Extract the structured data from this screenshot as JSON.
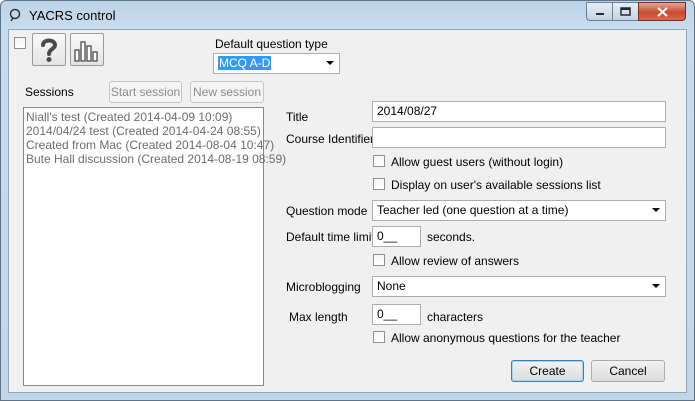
{
  "window": {
    "title": "YACRS control"
  },
  "toolbar": {
    "help_icon": "question-mark-icon",
    "chart_icon": "bar-chart-icon"
  },
  "question_type": {
    "label": "Default question type",
    "value": "MCQ A-D"
  },
  "sessions": {
    "label": "Sessions",
    "start_button": "Start session",
    "new_button": "New session",
    "items": [
      "Niall's test (Created 2014-04-09 10:09)",
      "2014/04/24 test (Created 2014-04-24 08:55)",
      "Created from Mac (Created 2014-08-04 10:47)",
      "Bute Hall discussion (Created 2014-08-19 08:59)"
    ]
  },
  "form": {
    "title_label": "Title",
    "title_value": "2014/08/27",
    "course_label": "Course Identifier",
    "course_value": "",
    "guest_label": "Allow guest users (without login)",
    "display_label": "Display on user's available sessions list",
    "mode_label": "Question mode",
    "mode_value": "Teacher led (one question at a time)",
    "time_label": "Default time limit",
    "time_value": "0__",
    "time_unit": "seconds.",
    "review_label": "Allow review of answers",
    "micro_label": "Microblogging",
    "micro_value": "None",
    "maxlen_label": "Max length",
    "maxlen_value": "0__",
    "maxlen_unit": "characters",
    "anon_label": "Allow anonymous questions for the teacher"
  },
  "actions": {
    "create": "Create",
    "cancel": "Cancel"
  },
  "colors": {
    "selection": "#3399ff",
    "titlebar": "#c9dcee",
    "close": "#c74a2e"
  }
}
